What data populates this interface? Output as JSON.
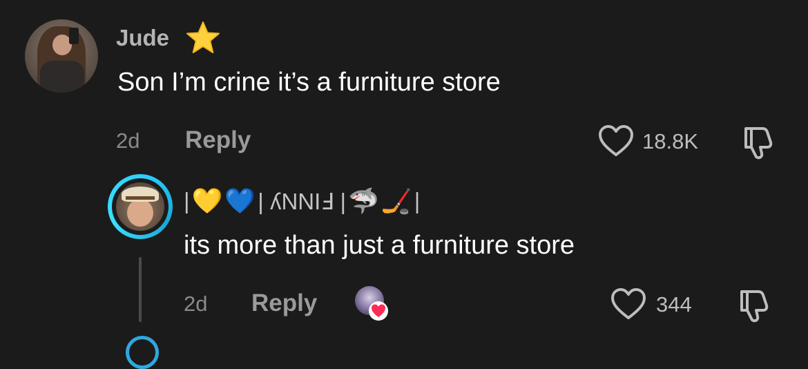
{
  "comments": [
    {
      "username": "Jude",
      "badge_icon": "star-icon",
      "text": "Son I’m crine it’s a furniture store",
      "age": "2d",
      "reply_label": "Reply",
      "likes": "18.8K"
    },
    {
      "username_prefix": "|",
      "username_emoji_1": "💛",
      "username_emoji_2": "💙",
      "username_middle": "| ʎNNIℲ |",
      "username_emoji_3": "🦈",
      "username_emoji_4": "🏒",
      "username_suffix": "|",
      "text": "its more than just a furniture store",
      "age": "2d",
      "reply_label": "Reply",
      "likes": "344"
    }
  ],
  "colors": {
    "background": "#1b1b1b",
    "story_ring": "#2fd0ff",
    "heart_red": "#fe2c55"
  }
}
